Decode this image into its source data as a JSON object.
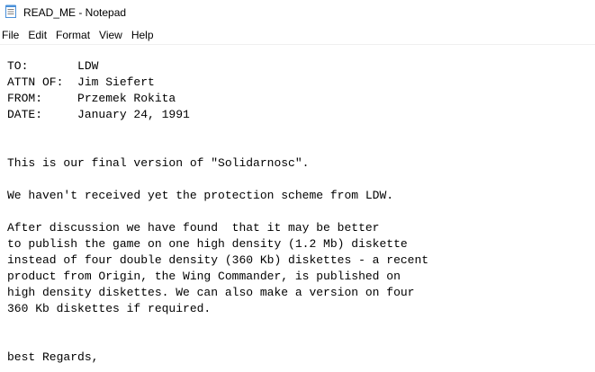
{
  "window": {
    "title": "READ_ME - Notepad",
    "icon": "notepad-icon"
  },
  "menubar": {
    "items": [
      {
        "label": "File"
      },
      {
        "label": "Edit"
      },
      {
        "label": "Format"
      },
      {
        "label": "View"
      },
      {
        "label": "Help"
      }
    ]
  },
  "document": {
    "content": "TO:       LDW\nATTN OF:  Jim Siefert\nFROM:     Przemek Rokita\nDATE:     January 24, 1991\n\n\nThis is our final version of \"Solidarnosc\".\n\nWe haven't received yet the protection scheme from LDW.\n\nAfter discussion we have found  that it may be better\nto publish the game on one high density (1.2 Mb) diskette\ninstead of four double density (360 Kb) diskettes - a recent\nproduct from Origin, the Wing Commander, is published on\nhigh density diskettes. We can also make a version on four\n360 Kb diskettes if required.\n\n\nbest Regards,"
  },
  "colors": {
    "background": "#ffffff",
    "text": "#000000",
    "icon_blue": "#4a90d9"
  }
}
